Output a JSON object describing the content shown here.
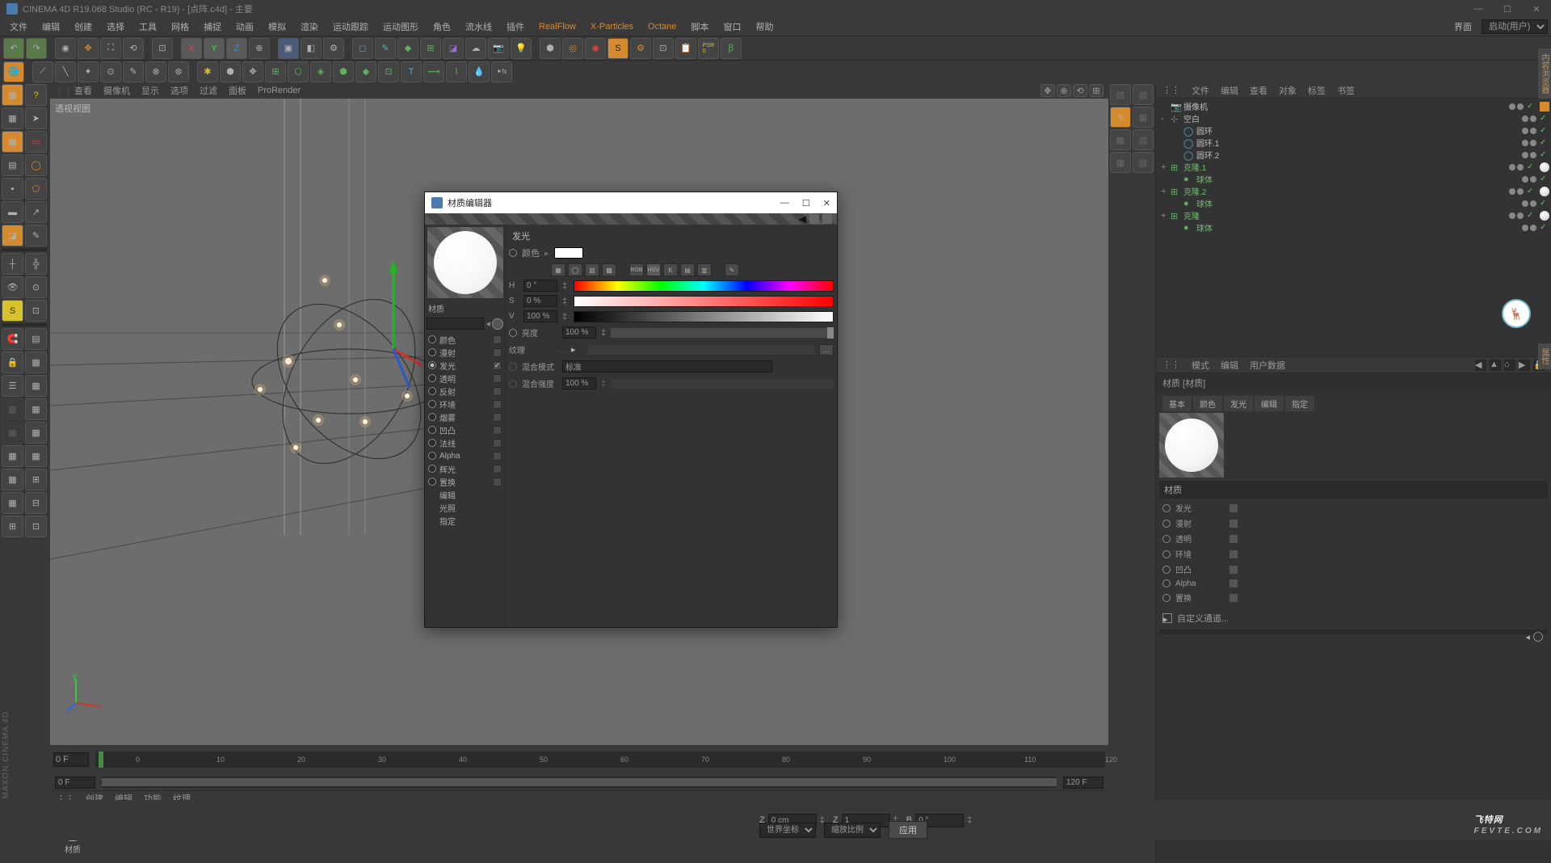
{
  "title": "CINEMA 4D R19.068 Studio (RC - R19) - [点阵.c4d] - 主要",
  "menus": [
    "文件",
    "编辑",
    "创建",
    "选择",
    "工具",
    "网格",
    "捕捉",
    "动画",
    "模拟",
    "渲染",
    "运动跟踪",
    "运动图形",
    "角色",
    "流水线",
    "插件",
    "RealFlow",
    "X-Particles",
    "Octane",
    "脚本",
    "窗口",
    "帮助"
  ],
  "plugin_menus": [
    "RealFlow",
    "X-Particles",
    "Octane"
  ],
  "layout_label": "界面",
  "layout_value": "启动(用户)",
  "viewport_tabs": [
    "查看",
    "摄像机",
    "显示",
    "选项",
    "过滤",
    "面板",
    "ProRender"
  ],
  "viewport_label": "透视视图",
  "timeline": {
    "frames": [
      0,
      10,
      20,
      30,
      40,
      50,
      60,
      70,
      80,
      90,
      100,
      110,
      120
    ],
    "start": "0 F",
    "currentstart": "0 F",
    "end": "120 F"
  },
  "mat_tabs": [
    "创建",
    "编辑",
    "功能",
    "纹理"
  ],
  "mat_name": "材质",
  "obj_tabs": [
    "文件",
    "编辑",
    "查看",
    "对象",
    "标签",
    "书签"
  ],
  "objects": [
    {
      "name": "摄像机",
      "type": "camera",
      "indent": 0,
      "active": true
    },
    {
      "name": "空白",
      "type": "null",
      "indent": 0,
      "exp": "-"
    },
    {
      "name": "圆环",
      "type": "circle",
      "indent": 1
    },
    {
      "name": "圆环.1",
      "type": "circle",
      "indent": 1
    },
    {
      "name": "圆环.2",
      "type": "circle",
      "indent": 1
    },
    {
      "name": "克隆.1",
      "type": "cloner",
      "indent": 0,
      "green": true,
      "exp": "+",
      "matTag": true
    },
    {
      "name": "球体",
      "type": "sphere",
      "indent": 1,
      "green": true
    },
    {
      "name": "克隆.2",
      "type": "cloner",
      "indent": 0,
      "green": true,
      "exp": "+",
      "matTag": true
    },
    {
      "name": "球体",
      "type": "sphere",
      "indent": 1,
      "green": true
    },
    {
      "name": "克隆",
      "type": "cloner",
      "indent": 0,
      "green": true,
      "exp": "+",
      "matTag": true
    },
    {
      "name": "球体",
      "type": "sphere",
      "indent": 1,
      "green": true
    }
  ],
  "attr_tabs": [
    "模式",
    "编辑",
    "用户数据"
  ],
  "attr_head": "材质 [材质]",
  "attr_subtabs": [
    "基本",
    "颜色",
    "发光",
    "编辑",
    "指定"
  ],
  "attr_group": "材质",
  "attr_channels": [
    {
      "name": "发光"
    },
    {
      "name": "漫射"
    },
    {
      "name": "透明"
    },
    {
      "name": "环境"
    },
    {
      "name": "凹凸"
    },
    {
      "name": "Alpha"
    },
    {
      "name": "置换"
    }
  ],
  "attr_custom_channel": "自定义通道...",
  "mat_editor": {
    "title": "材质编辑器",
    "left_head": "材质",
    "channels": [
      {
        "name": "颜色",
        "radio": true,
        "chk": false
      },
      {
        "name": "漫射",
        "radio": true,
        "chk": false
      },
      {
        "name": "发光",
        "radio": true,
        "chk": true,
        "sel": true
      },
      {
        "name": "透明",
        "radio": true,
        "chk": false
      },
      {
        "name": "反射",
        "radio": true,
        "chk": false
      },
      {
        "name": "环境",
        "radio": true,
        "chk": false
      },
      {
        "name": "烟雾",
        "radio": true,
        "chk": false
      },
      {
        "name": "凹凸",
        "radio": true,
        "chk": false
      },
      {
        "name": "法线",
        "radio": true,
        "chk": false
      },
      {
        "name": "Alpha",
        "radio": true,
        "chk": false
      },
      {
        "name": "辉光",
        "radio": true,
        "chk": false
      },
      {
        "name": "置换",
        "radio": true,
        "chk": false
      },
      {
        "name": "编辑",
        "sub": true
      },
      {
        "name": "光照",
        "sub": true
      },
      {
        "name": "指定",
        "sub": true
      }
    ],
    "section": "发光",
    "color_label": "颜色",
    "H": "0 °",
    "S": "0 %",
    "V": "100 %",
    "brightness_label": "亮度",
    "brightness": "100 %",
    "texture_label": "纹理",
    "texture": "",
    "blend_mode_label": "混合模式",
    "blend_mode": "标准",
    "blend_strength_label": "混合强度",
    "blend_strength": "100 %"
  },
  "status": {
    "Z": "0 cm",
    "sZ": "1",
    "B": "0 °",
    "space": "世界坐标",
    "scale": "缩放比例",
    "apply": "应用"
  },
  "brand": "MAXON CINEMA 4D",
  "watermark": "飞特网",
  "watermark_sub": "FEVTE.COM"
}
